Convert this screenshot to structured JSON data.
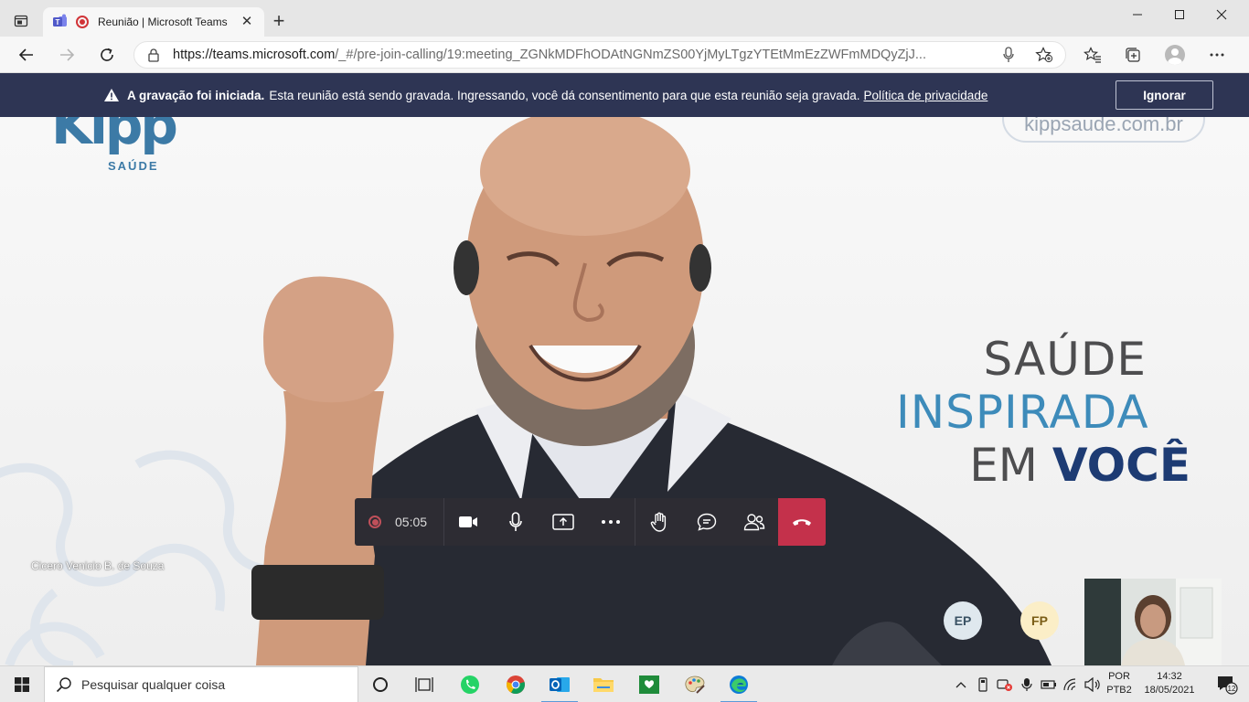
{
  "browser": {
    "tab_title": "Reunião | Microsoft Teams",
    "url_main": "https://teams.microsoft.com",
    "url_rest": "/_#/pre-join-calling/19:meeting_ZGNkMDFhODAtNGNmZS00YjMyLTgzYTEtMmEzZWFmMDQyZjJ..."
  },
  "banner": {
    "title": "A gravação foi iniciada.",
    "message": "Esta reunião está sendo gravada. Ingressando, você dá consentimento para que esta reunião seja gravada.",
    "link": "Política de privacidade",
    "ignore_label": "Ignorar"
  },
  "video": {
    "brand_logo": "Kipp",
    "brand_sub": "SAÚDE",
    "site": "kippsaude.com.br",
    "slogan_line1": "SAÚDE",
    "slogan_line2": "INSPIRADA",
    "slogan_line3_prefix": "EM ",
    "slogan_line3_bold": "VOCÊ",
    "participant_name": "Cicero Venicio B. de Souza"
  },
  "controls": {
    "timer": "05:05"
  },
  "participants": [
    {
      "initials": "EP"
    },
    {
      "initials": "FP"
    }
  ],
  "taskbar": {
    "search_placeholder": "Pesquisar qualquer coisa",
    "lang_line1": "POR",
    "lang_line2": "PTB2",
    "time": "14:32",
    "date": "18/05/2021",
    "notification_count": "12"
  },
  "colors": {
    "banner_bg": "#2e3554",
    "hangup": "#c4314b",
    "controls_bg": "#2d2c33",
    "brand_blue": "#3c7aa6"
  }
}
